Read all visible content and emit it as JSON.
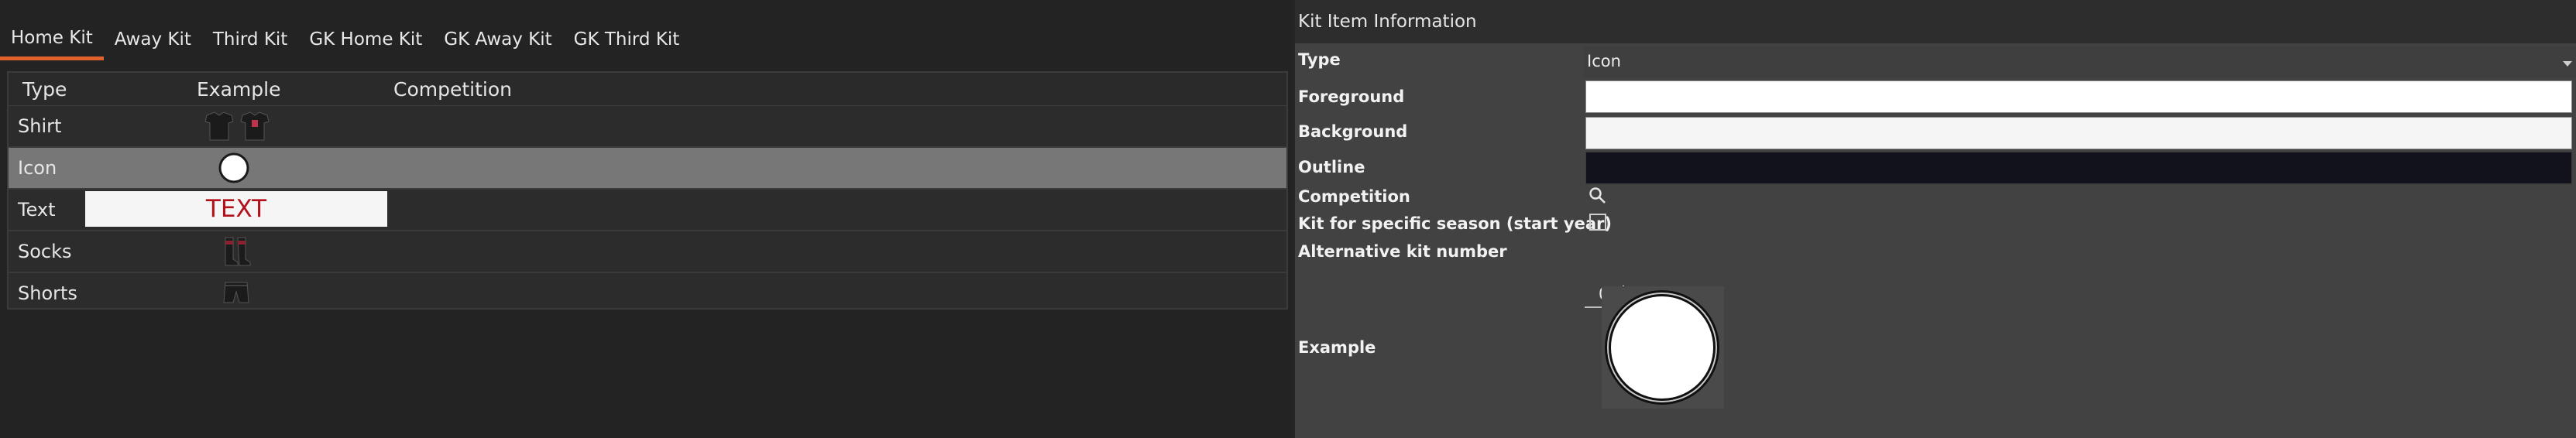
{
  "tabs": [
    {
      "label": "Home Kit",
      "active": true
    },
    {
      "label": "Away Kit",
      "active": false
    },
    {
      "label": "Third Kit",
      "active": false
    },
    {
      "label": "GK Home Kit",
      "active": false
    },
    {
      "label": "GK Away Kit",
      "active": false
    },
    {
      "label": "GK Third Kit",
      "active": false
    }
  ],
  "table": {
    "headers": {
      "type": "Type",
      "example": "Example",
      "competition": "Competition"
    },
    "rows": [
      {
        "type": "Shirt",
        "example_icon": "shirt-icon",
        "competition": ""
      },
      {
        "type": "Icon",
        "example_icon": "white-circle-icon",
        "competition": "",
        "selected": true
      },
      {
        "type": "Text",
        "example_text": "TEXT",
        "competition": ""
      },
      {
        "type": "Socks",
        "example_icon": "socks-icon",
        "competition": ""
      },
      {
        "type": "Shorts",
        "example_icon": "shorts-icon",
        "competition": ""
      }
    ]
  },
  "info": {
    "title": "Kit Item Information",
    "type_label": "Type",
    "type_value": "Icon",
    "foreground_label": "Foreground",
    "foreground_color": "#ffffff",
    "background_label": "Background",
    "background_color": "#f5f5f5",
    "outline_label": "Outline",
    "outline_color": "#12121c",
    "competition_label": "Competition",
    "season_label": "Kit for specific season (start year)",
    "season_checked": false,
    "altnum_label": "Alternative kit number",
    "altnum_value": "0",
    "example_label": "Example"
  },
  "colors": {
    "accent": "#e0622a",
    "selected_row": "#777777",
    "text_red": "#b2101a"
  }
}
